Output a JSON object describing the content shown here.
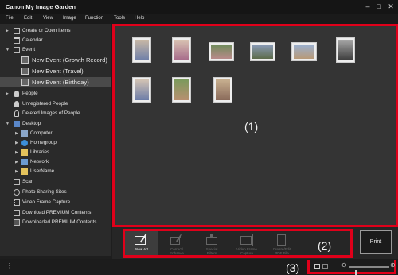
{
  "window": {
    "title": "Canon My Image Garden"
  },
  "menu": [
    "File",
    "Edit",
    "View",
    "Image",
    "Function",
    "Tools",
    "Help"
  ],
  "sidebar": {
    "items": [
      {
        "label": "Create or Open Items",
        "icon": "create-items-icon"
      },
      {
        "label": "Calendar",
        "icon": "calendar-icon"
      },
      {
        "label": "Event",
        "icon": "event-icon"
      },
      {
        "label": "New Event (Growth Record)",
        "icon": "event-photo-icon"
      },
      {
        "label": "New Event (Travel)",
        "icon": "event-photo-icon"
      },
      {
        "label": "New Event (Birthday)",
        "icon": "event-photo-icon"
      },
      {
        "label": "People",
        "icon": "person-icon"
      },
      {
        "label": "Unregistered People",
        "icon": "person-icon"
      },
      {
        "label": "Deleted Images of People",
        "icon": "person-icon"
      },
      {
        "label": "Desktop",
        "icon": "desktop-icon"
      },
      {
        "label": "Computer",
        "icon": "computer-icon"
      },
      {
        "label": "Homegroup",
        "icon": "homegroup-icon"
      },
      {
        "label": "Libraries",
        "icon": "folder-icon"
      },
      {
        "label": "Network",
        "icon": "network-icon"
      },
      {
        "label": "UserName",
        "icon": "folder-icon"
      },
      {
        "label": "Scan",
        "icon": "scan-icon"
      },
      {
        "label": "Photo Sharing Sites",
        "icon": "photo-sharing-icon"
      },
      {
        "label": "Video Frame Capture",
        "icon": "video-icon"
      },
      {
        "label": "Download PREMIUM Contents",
        "icon": "download-icon"
      },
      {
        "label": "Downloaded PREMIUM Contents",
        "icon": "downloaded-icon"
      }
    ]
  },
  "main": {
    "area_label": "(1)"
  },
  "toolbar": {
    "area_label": "(2)",
    "tools": [
      {
        "label": "New Art",
        "enabled": true
      },
      {
        "label": "Correct/\nEnhance",
        "enabled": false
      },
      {
        "label": "Special\nFilters",
        "enabled": false
      },
      {
        "label": "Video Frame\nCapture",
        "enabled": false
      },
      {
        "label": "Create/Edit\nPDF File",
        "enabled": false
      }
    ],
    "print_label": "Print"
  },
  "status": {
    "area_label": "(3)",
    "zoom_fraction": 0.15
  },
  "colors": {
    "highlight": "#e0001a",
    "background": "#343434"
  }
}
